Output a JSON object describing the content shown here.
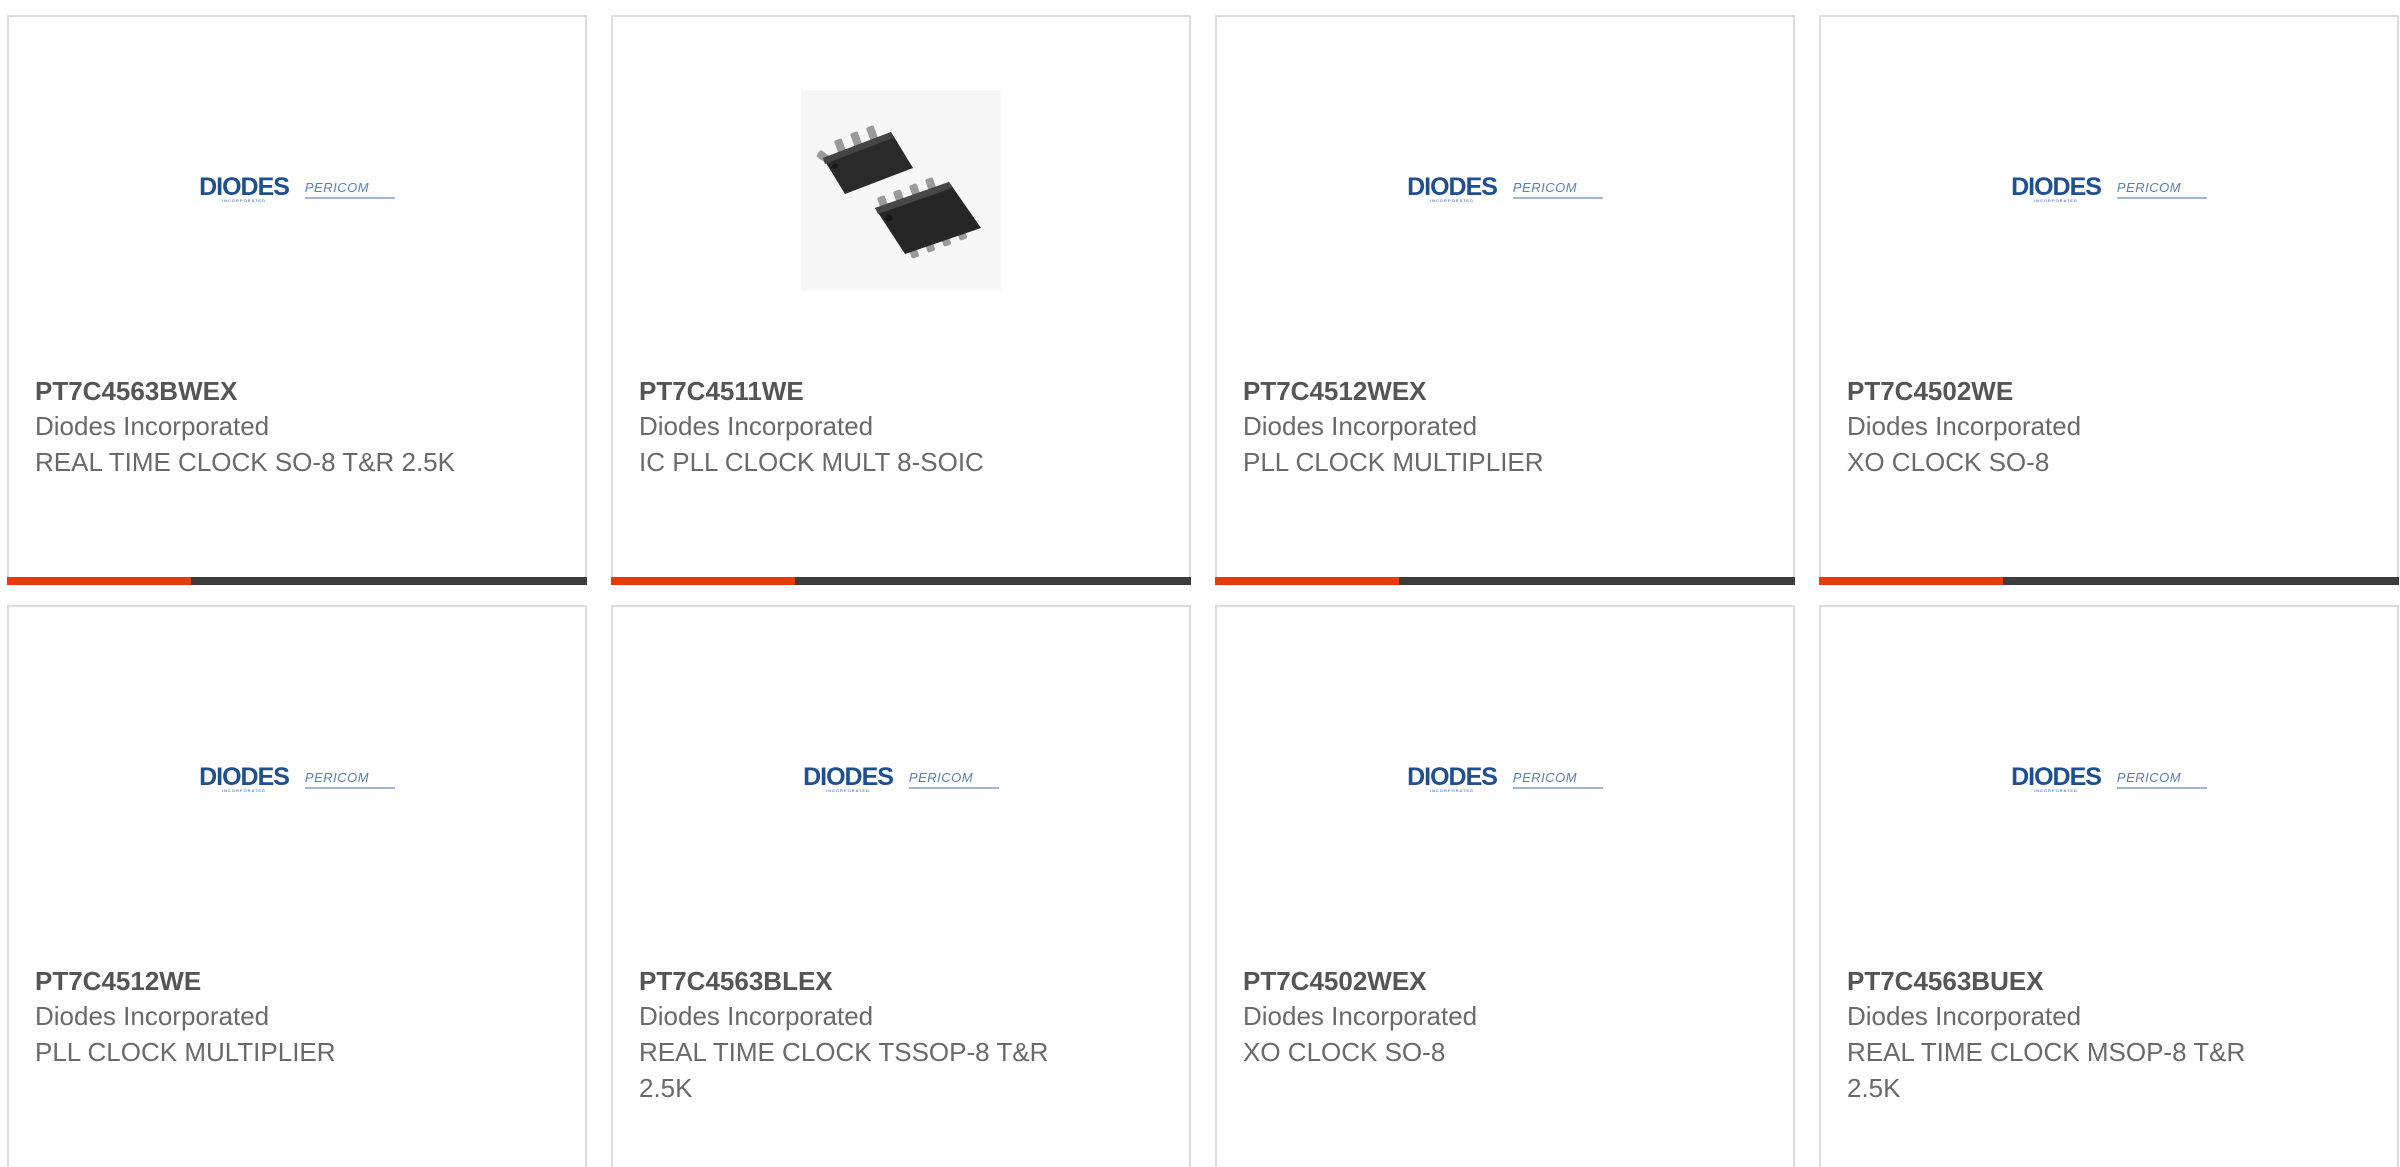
{
  "logo": {
    "primary": "DIODES",
    "primary_sub": "INCORPORATED",
    "secondary": "PERICOM"
  },
  "colors": {
    "accent": "#e8380d",
    "bar_dark": "#3c3c3c",
    "logo_blue": "#1d4f91"
  },
  "products": [
    {
      "part_number": "PT7C4563BWEX",
      "manufacturer": "Diodes Incorporated",
      "description": "REAL TIME CLOCK SO-8 T&R 2.5K",
      "image": "diodes-pericom-logo"
    },
    {
      "part_number": "PT7C4511WE",
      "manufacturer": "Diodes Incorporated",
      "description": "IC PLL CLOCK MULT 8-SOIC",
      "image": "soic-8-chip-photo"
    },
    {
      "part_number": "PT7C4512WEX",
      "manufacturer": "Diodes Incorporated",
      "description": "PLL CLOCK MULTIPLIER",
      "image": "diodes-pericom-logo"
    },
    {
      "part_number": "PT7C4502WE",
      "manufacturer": "Diodes Incorporated",
      "description": "XO CLOCK SO-8",
      "image": "diodes-pericom-logo"
    },
    {
      "part_number": "PT7C4512WE",
      "manufacturer": "Diodes Incorporated",
      "description": "PLL CLOCK MULTIPLIER",
      "image": "diodes-pericom-logo"
    },
    {
      "part_number": "PT7C4563BLEX",
      "manufacturer": "Diodes Incorporated",
      "description": "REAL TIME CLOCK TSSOP-8 T&R 2.5K",
      "image": "diodes-pericom-logo"
    },
    {
      "part_number": "PT7C4502WEX",
      "manufacturer": "Diodes Incorporated",
      "description": "XO CLOCK SO-8",
      "image": "diodes-pericom-logo"
    },
    {
      "part_number": "PT7C4563BUEX",
      "manufacturer": "Diodes Incorporated",
      "description": "REAL TIME CLOCK MSOP-8 T&R 2.5K",
      "image": "diodes-pericom-logo"
    }
  ]
}
